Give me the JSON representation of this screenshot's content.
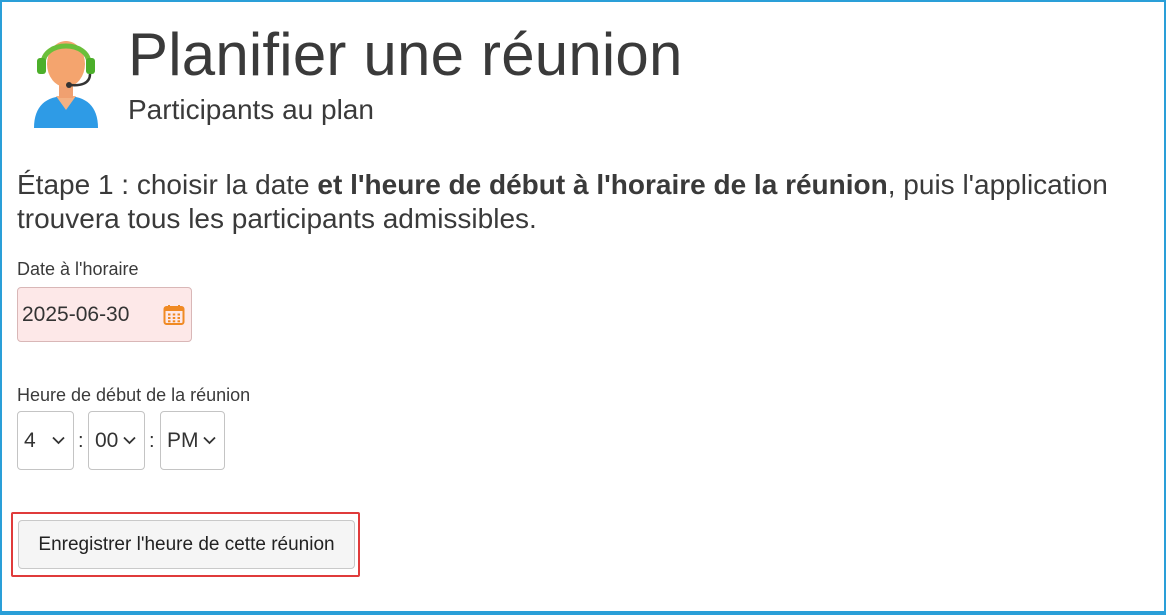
{
  "header": {
    "title": "Planifier une réunion",
    "subtitle": "Participants au plan",
    "avatar_icon": "support-agent-headset-icon"
  },
  "step": {
    "prefix": "Étape 1 : choisir la date ",
    "bold": "et l'heure de début à l'horaire de la réunion",
    "suffix": ", puis l'application trouvera tous les participants admissibles."
  },
  "date_field": {
    "label": "Date à l'horaire",
    "value": "2025-06-30",
    "icon": "calendar-icon"
  },
  "time": {
    "label": "Heure de début de la réunion",
    "hour": "4",
    "minute": "00",
    "ampm": "PM",
    "separator": ":"
  },
  "actions": {
    "save_label": "Enregistrer l'heure de cette réunion"
  },
  "colors": {
    "frame_border": "#2a9fd8",
    "date_invalid_bg": "#fde8e8",
    "highlight_border": "#e03b3b",
    "calendar_icon": "#f08a24"
  }
}
